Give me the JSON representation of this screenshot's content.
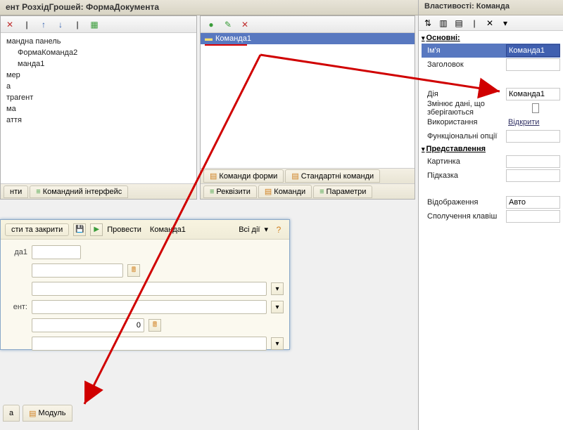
{
  "titlebar": "ент РозхідГрошей: ФормаДокумента",
  "tree": {
    "items": [
      "мандна панель",
      "ФормаКоманда2",
      "манда1",
      "мер",
      "а",
      "трагент",
      "ма",
      "аття"
    ]
  },
  "tree_tabs": {
    "t1": "нти",
    "t2": "Командний інтерфейс"
  },
  "cmd": {
    "item": "Команда1",
    "tabs": {
      "t1": "Команди форми",
      "t2": "Стандартні команди",
      "t3": "Реквізити",
      "t4": "Команди",
      "t5": "Параметри"
    }
  },
  "form": {
    "close": "сти та закрити",
    "provesty": "Провести",
    "cmd1": "Команда1",
    "allactions": "Всі дії",
    "row1_label": "да1",
    "row4_label": "ент:",
    "num_zero": "0",
    "calc_icon": "🖩"
  },
  "lower_tabs": {
    "t1": "а",
    "t2": "Модуль"
  },
  "props": {
    "title": "Властивості: Команда",
    "section_main": "Основні:",
    "name_label": "Ім'я",
    "name_value": "Команда1",
    "title_label": "Заголовок",
    "action_label": "Дія",
    "action_value": "Команда1",
    "changes_label": "Змінює дані, що зберігаються",
    "usage_label": "Використання",
    "usage_value": "Відкрити",
    "funcopt_label": "Функціональні опції",
    "section_pres": "Представлення",
    "pic_label": "Картинка",
    "hint_label": "Підказка",
    "display_label": "Відображення",
    "display_value": "Авто",
    "shortcut_label": "Сполучення клавіш"
  }
}
